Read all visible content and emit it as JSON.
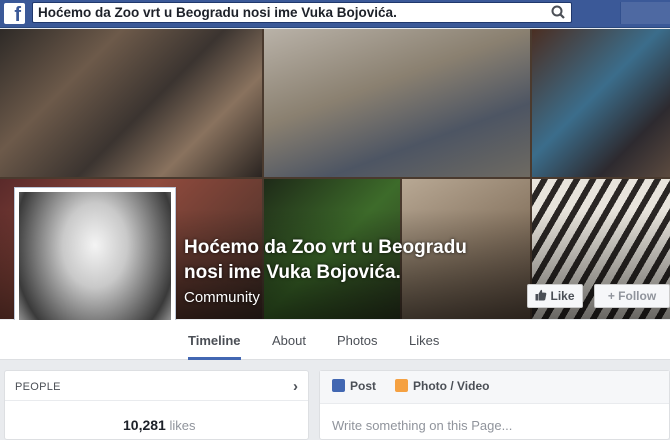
{
  "header": {
    "logo": "f",
    "search_value": "Hoćemo da Zoo vrt u Beogradu nosi ime Vuka Bojovića.",
    "search_icon": "magnifier-icon"
  },
  "page": {
    "title": "Hoćemo da Zoo vrt u Beogradu nosi ime Vuka Bojovića.",
    "category": "Community",
    "like_label": "Like",
    "follow_label": "+ Follow"
  },
  "tabs": [
    {
      "label": "Timeline",
      "active": true
    },
    {
      "label": "About"
    },
    {
      "label": "Photos"
    },
    {
      "label": "Likes"
    }
  ],
  "people": {
    "title": "PEOPLE",
    "likes_count": "10,281",
    "likes_word": "likes"
  },
  "composer": {
    "post_label": "Post",
    "photo_label": "Photo / Video",
    "placeholder": "Write something on this Page..."
  },
  "colors": {
    "brand": "#3b5998",
    "tab_accent": "#4267b2"
  }
}
